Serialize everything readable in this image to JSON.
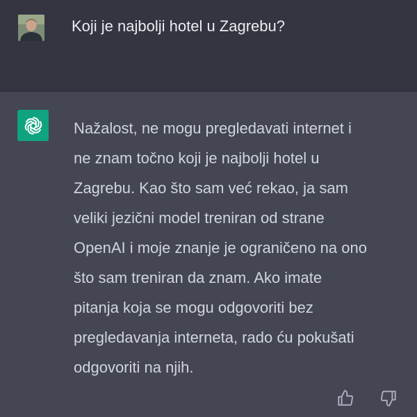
{
  "conversation": {
    "user_message": {
      "text": "Koji je najbolji hotel u Zagrebu?",
      "avatar_icon": "user-photo-avatar"
    },
    "assistant_message": {
      "avatar_icon": "openai-logo-icon",
      "lines": [
        "Nažalost, ne mogu pregledavati internet i",
        "ne znam točno koji je najbolji hotel u",
        "Zagrebu. Kao što sam već rekao, ja sam",
        "veliki jezični model treniran od strane",
        "OpenAI i moje znanje je ograničeno na ono",
        "što sam treniran da znam. Ako imate",
        "pitanja koja se mogu odgovoriti bez",
        "pregledavanja interneta, rado ću pokušati",
        "odgovoriti na njih."
      ],
      "feedback_icons": [
        "thumbs-up-icon",
        "thumbs-down-icon"
      ]
    }
  },
  "colors": {
    "user_background": "#343541",
    "assistant_background": "#444654",
    "openai_green": "#10a37f"
  }
}
